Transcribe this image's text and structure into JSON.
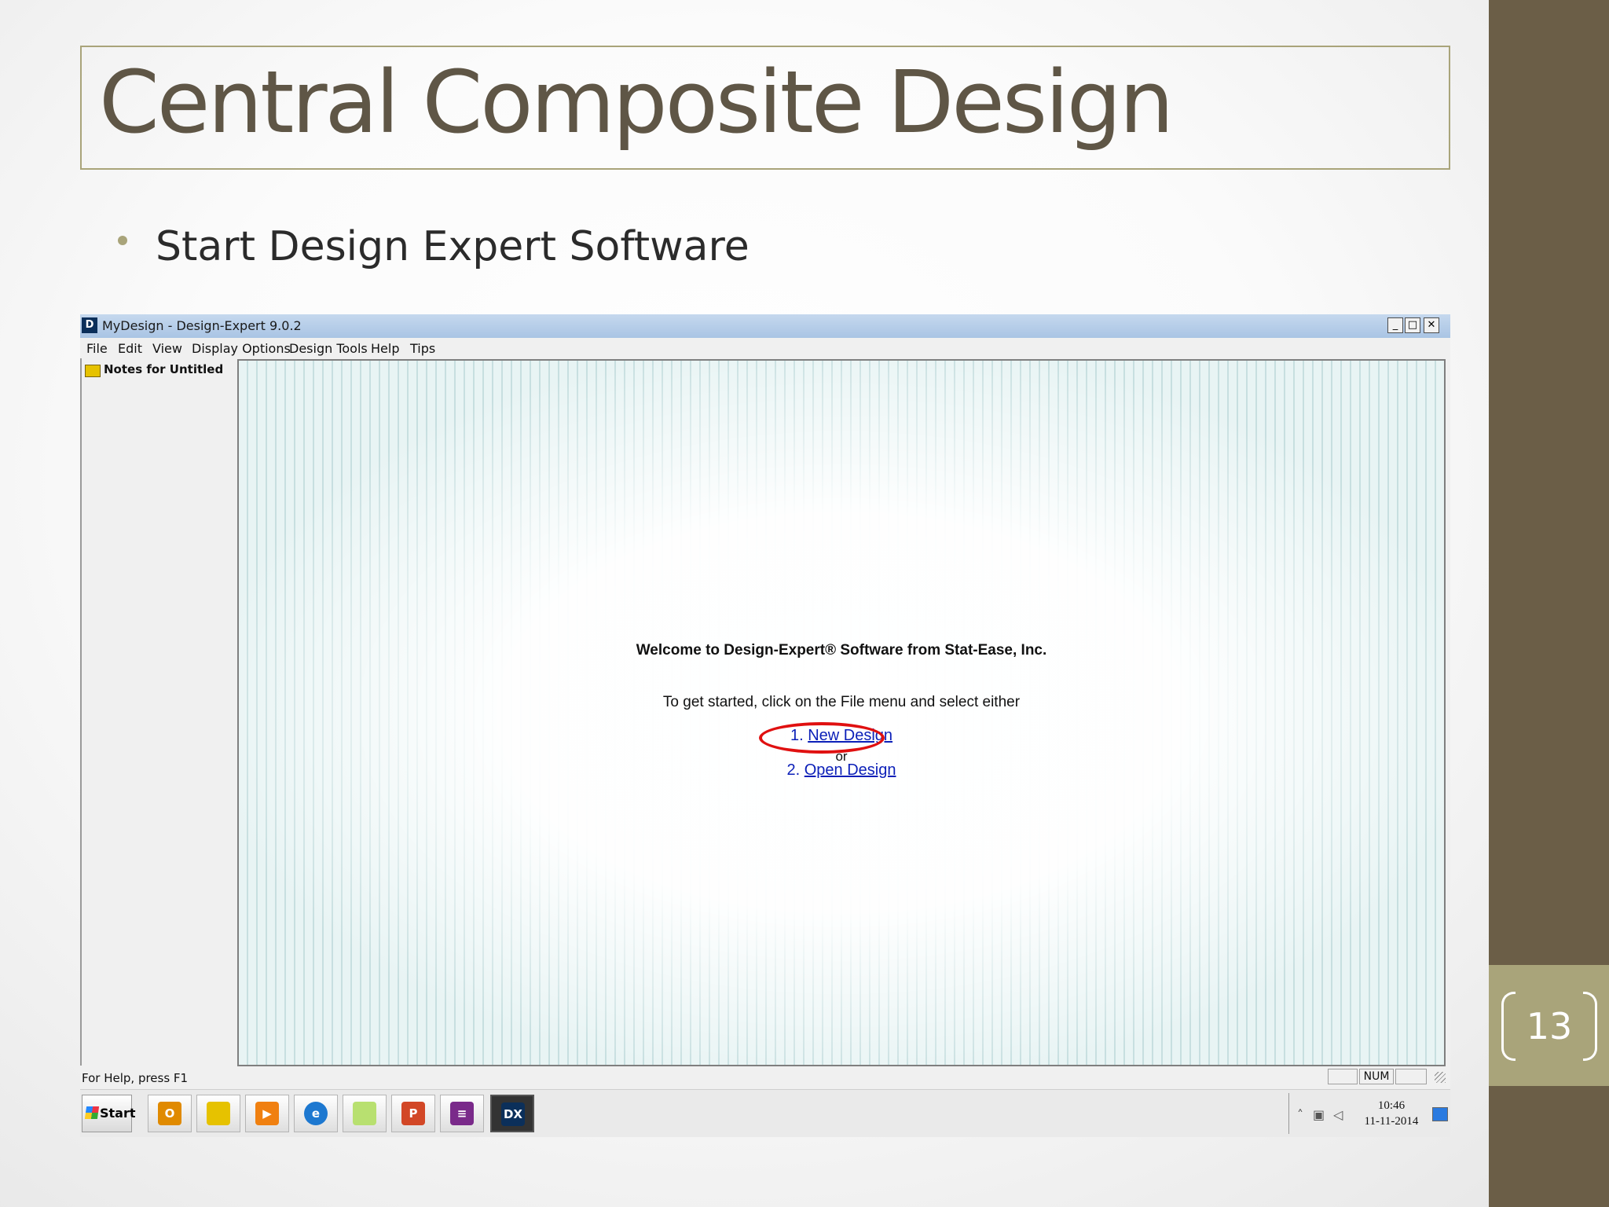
{
  "slide": {
    "title": "Central Composite Design",
    "bullet": "Start Design Expert Software",
    "page_number": "13",
    "colors": {
      "sidebar": "#6b5e47",
      "accent": "#a9a47a",
      "title_text": "#5f5646"
    }
  },
  "window": {
    "title": "MyDesign - Design-Expert 9.0.2",
    "icon_glyph": "D",
    "minimize_glyph": "_",
    "maximize_glyph": "□",
    "close_glyph": "✕",
    "menu": [
      "File",
      "Edit",
      "View",
      "Display Options",
      "Design Tools",
      "Help",
      "Tips"
    ]
  },
  "left_panel": {
    "label": "Notes for Untitled"
  },
  "welcome": {
    "heading": "Welcome to Design-Expert® Software from Stat-Ease, Inc.",
    "instruction": "To get started, click on the File menu and select either",
    "option1_num": "1.",
    "option1_link": "New Design",
    "or_text": "or",
    "option2_num": "2.",
    "option2_link": "Open Design",
    "highlight_color": "#e01010",
    "link_color": "#0b1fb8"
  },
  "status_bar": {
    "help_text": "For Help, press F1",
    "num": "NUM"
  },
  "taskbar": {
    "start_label": "Start",
    "apps": [
      {
        "icon": "outlook-icon",
        "glyph": "O",
        "color": "#e08a00"
      },
      {
        "icon": "folder-icon",
        "glyph": "",
        "color": "#e6c200"
      },
      {
        "icon": "media-player-icon",
        "glyph": "▶",
        "color": "#f08010"
      },
      {
        "icon": "internet-explorer-icon",
        "glyph": "e",
        "color": "#1d78d0"
      },
      {
        "icon": "sticky-notes-icon",
        "glyph": "",
        "color": "#b8e070"
      },
      {
        "icon": "powerpoint-icon",
        "glyph": "P",
        "color": "#d24726"
      },
      {
        "icon": "winrar-icon",
        "glyph": "≡",
        "color": "#7a2a8a"
      },
      {
        "icon": "design-expert-icon",
        "glyph": "DX",
        "color": "#0b2f5a"
      }
    ],
    "tray_arrow": "˄",
    "clock_time": "10:46",
    "clock_date": "11-11-2014"
  }
}
